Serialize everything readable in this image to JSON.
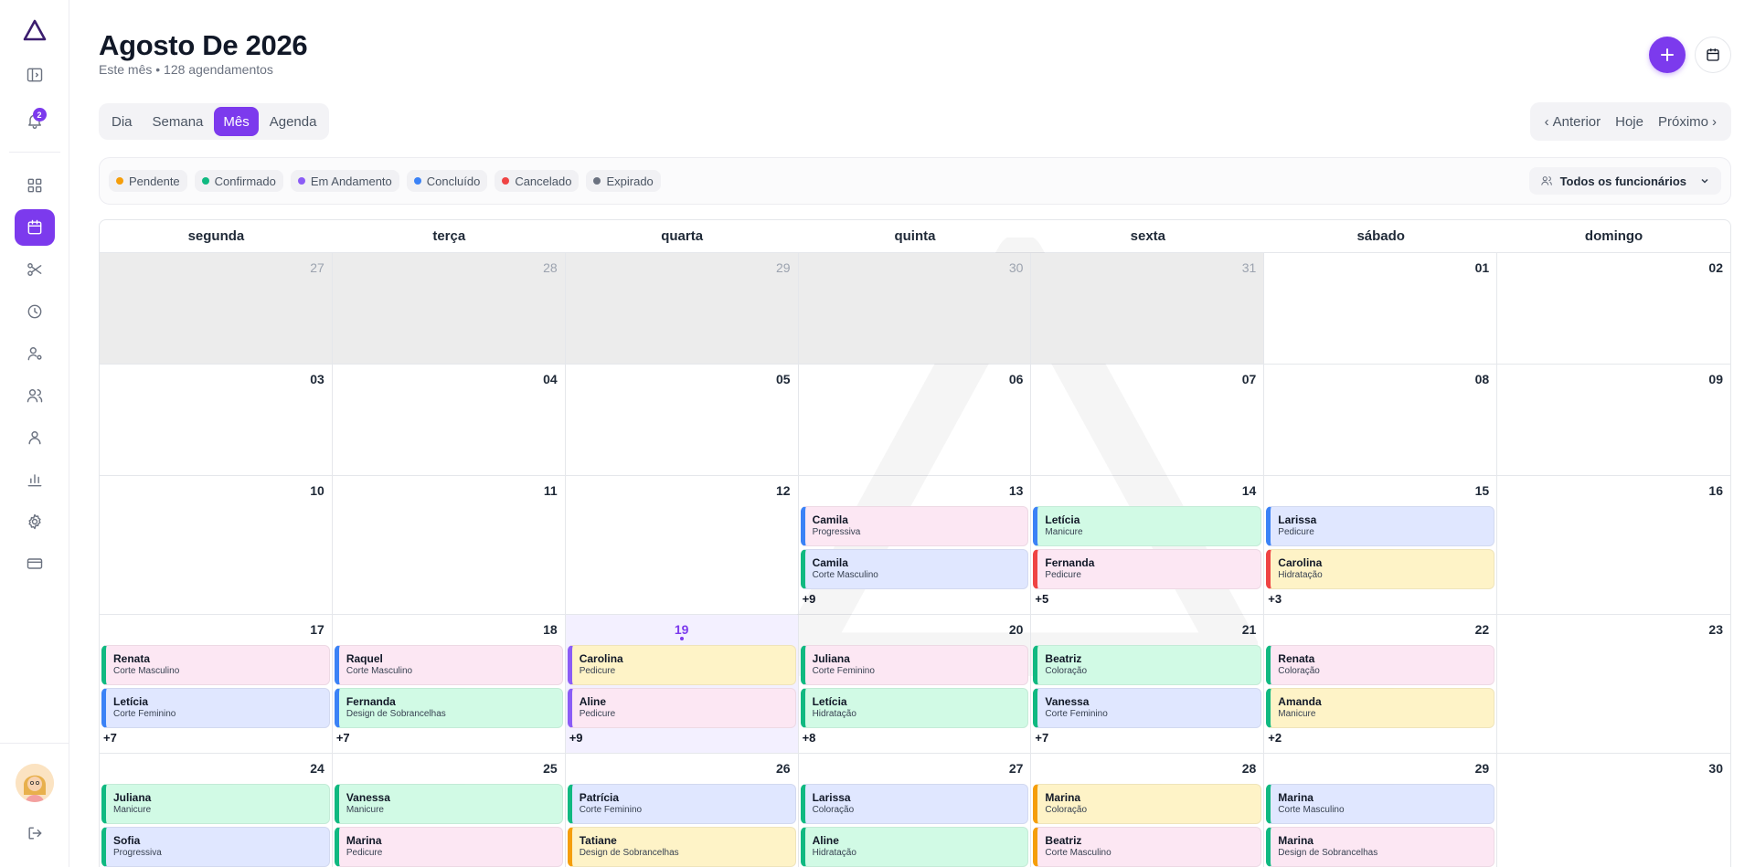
{
  "header": {
    "title": "Agosto De 2026",
    "subtitle": "Este mês • 128 agendamentos"
  },
  "sidebar": {
    "notifications_count": "2",
    "items": [
      "logo-icon",
      "sidebar-toggle-icon",
      "bell-icon",
      "dashboard-icon",
      "calendar-icon",
      "scissors-icon",
      "clock-icon",
      "user-settings-icon",
      "users-icon",
      "user-icon",
      "chart-icon",
      "gear-icon",
      "card-icon"
    ]
  },
  "views": {
    "day": "Dia",
    "week": "Semana",
    "month": "Mês",
    "agenda": "Agenda",
    "active": "Mês"
  },
  "pager": {
    "prev": "Anterior",
    "today": "Hoje",
    "next": "Próximo"
  },
  "legend": [
    {
      "label": "Pendente",
      "color": "#f59e0b"
    },
    {
      "label": "Confirmado",
      "color": "#10b981"
    },
    {
      "label": "Em Andamento",
      "color": "#8b5cf6"
    },
    {
      "label": "Concluído",
      "color": "#3b82f6"
    },
    {
      "label": "Cancelado",
      "color": "#ef4444"
    },
    {
      "label": "Expirado",
      "color": "#6b7280"
    }
  ],
  "staff_filter": "Todos os funcionários",
  "weekdays": [
    "segunda",
    "terça",
    "quarta",
    "quinta",
    "sexta",
    "sábado",
    "domingo"
  ],
  "weeks": [
    [
      {
        "num": "27",
        "other": true
      },
      {
        "num": "28",
        "other": true
      },
      {
        "num": "29",
        "other": true
      },
      {
        "num": "30",
        "other": true
      },
      {
        "num": "31",
        "other": true
      },
      {
        "num": "01"
      },
      {
        "num": "02"
      }
    ],
    [
      {
        "num": "03"
      },
      {
        "num": "04"
      },
      {
        "num": "05"
      },
      {
        "num": "06"
      },
      {
        "num": "07"
      },
      {
        "num": "08"
      },
      {
        "num": "09"
      }
    ],
    [
      {
        "num": "10"
      },
      {
        "num": "11"
      },
      {
        "num": "12"
      },
      {
        "num": "13",
        "appts": [
          {
            "name": "Camila",
            "service": "Progressiva",
            "bg": "pink",
            "bar": "blue"
          },
          {
            "name": "Camila",
            "service": "Corte Masculino",
            "bg": "blue",
            "bar": "green"
          }
        ],
        "more": "+9"
      },
      {
        "num": "14",
        "appts": [
          {
            "name": "Letícia",
            "service": "Manicure",
            "bg": "green",
            "bar": "blue"
          },
          {
            "name": "Fernanda",
            "service": "Pedicure",
            "bg": "pink",
            "bar": "red"
          }
        ],
        "more": "+5"
      },
      {
        "num": "15",
        "appts": [
          {
            "name": "Larissa",
            "service": "Pedicure",
            "bg": "blue",
            "bar": "blue"
          },
          {
            "name": "Carolina",
            "service": "Hidratação",
            "bg": "yellow",
            "bar": "red"
          }
        ],
        "more": "+3"
      },
      {
        "num": "16"
      }
    ],
    [
      {
        "num": "17",
        "appts": [
          {
            "name": "Renata",
            "service": "Corte Masculino",
            "bg": "pink",
            "bar": "green"
          },
          {
            "name": "Letícia",
            "service": "Corte Feminino",
            "bg": "blue",
            "bar": "blue"
          }
        ],
        "more": "+7"
      },
      {
        "num": "18",
        "appts": [
          {
            "name": "Raquel",
            "service": "Corte Masculino",
            "bg": "pink",
            "bar": "blue"
          },
          {
            "name": "Fernanda",
            "service": "Design de Sobrancelhas",
            "bg": "green",
            "bar": "blue"
          }
        ],
        "more": "+7"
      },
      {
        "num": "19",
        "today": true,
        "appts": [
          {
            "name": "Carolina",
            "service": "Pedicure",
            "bg": "yellow",
            "bar": "purple"
          },
          {
            "name": "Aline",
            "service": "Pedicure",
            "bg": "pink",
            "bar": "purple"
          }
        ],
        "more": "+9"
      },
      {
        "num": "20",
        "appts": [
          {
            "name": "Juliana",
            "service": "Corte Feminino",
            "bg": "pink",
            "bar": "green"
          },
          {
            "name": "Letícia",
            "service": "Hidratação",
            "bg": "green",
            "bar": "green"
          }
        ],
        "more": "+8"
      },
      {
        "num": "21",
        "appts": [
          {
            "name": "Beatriz",
            "service": "Coloração",
            "bg": "green",
            "bar": "green"
          },
          {
            "name": "Vanessa",
            "service": "Corte Feminino",
            "bg": "blue",
            "bar": "green"
          }
        ],
        "more": "+7"
      },
      {
        "num": "22",
        "appts": [
          {
            "name": "Renata",
            "service": "Coloração",
            "bg": "pink",
            "bar": "green"
          },
          {
            "name": "Amanda",
            "service": "Manicure",
            "bg": "yellow",
            "bar": "green"
          }
        ],
        "more": "+2"
      },
      {
        "num": "23"
      }
    ],
    [
      {
        "num": "24",
        "appts": [
          {
            "name": "Juliana",
            "service": "Manicure",
            "bg": "green",
            "bar": "green"
          },
          {
            "name": "Sofia",
            "service": "Progressiva",
            "bg": "blue",
            "bar": "green"
          }
        ]
      },
      {
        "num": "25",
        "appts": [
          {
            "name": "Vanessa",
            "service": "Manicure",
            "bg": "green",
            "bar": "green"
          },
          {
            "name": "Marina",
            "service": "Pedicure",
            "bg": "pink",
            "bar": "green"
          }
        ]
      },
      {
        "num": "26",
        "appts": [
          {
            "name": "Patrícia",
            "service": "Corte Feminino",
            "bg": "blue",
            "bar": "green"
          },
          {
            "name": "Tatiane",
            "service": "Design de Sobrancelhas",
            "bg": "yellow",
            "bar": "orange"
          }
        ]
      },
      {
        "num": "27",
        "appts": [
          {
            "name": "Larissa",
            "service": "Coloração",
            "bg": "blue",
            "bar": "green"
          },
          {
            "name": "Aline",
            "service": "Hidratação",
            "bg": "green",
            "bar": "green"
          }
        ]
      },
      {
        "num": "28",
        "appts": [
          {
            "name": "Marina",
            "service": "Coloração",
            "bg": "yellow",
            "bar": "orange"
          },
          {
            "name": "Beatriz",
            "service": "Corte Masculino",
            "bg": "pink",
            "bar": "orange"
          }
        ]
      },
      {
        "num": "29",
        "appts": [
          {
            "name": "Marina",
            "service": "Corte Masculino",
            "bg": "blue",
            "bar": "green"
          },
          {
            "name": "Marina",
            "service": "Design de Sobrancelhas",
            "bg": "pink",
            "bar": "green"
          }
        ]
      },
      {
        "num": "30"
      }
    ]
  ],
  "colors": {
    "accent": "#7c3aed"
  }
}
